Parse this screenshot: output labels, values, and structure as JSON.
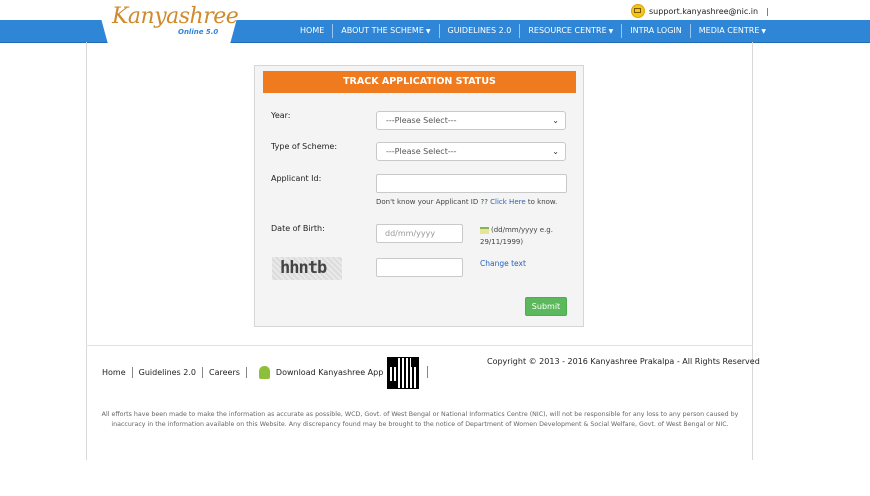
{
  "header": {
    "logo_text": "Kanyashree",
    "logo_sub": "Online 5.0",
    "support_email": "support.kanyashree@nic.in"
  },
  "nav": {
    "items": [
      {
        "label": "HOME",
        "dropdown": false
      },
      {
        "label": "ABOUT THE SCHEME",
        "dropdown": true
      },
      {
        "label": "GUIDELINES 2.0",
        "dropdown": false
      },
      {
        "label": "RESOURCE CENTRE",
        "dropdown": true
      },
      {
        "label": "INTRA LOGIN",
        "dropdown": false
      },
      {
        "label": "MEDIA CENTRE",
        "dropdown": true
      }
    ]
  },
  "form": {
    "title": "TRACK APPLICATION STATUS",
    "year_label": "Year:",
    "year_value": "---Please Select---",
    "scheme_label": "Type of Scheme:",
    "scheme_value": "---Please Select---",
    "applicant_label": "Applicant Id:",
    "applicant_value": "",
    "applicant_hint_pre": "Don't know your Applicant ID ??",
    "applicant_hint_link": "Click Here",
    "applicant_hint_post": "to know.",
    "dob_label": "Date of Birth:",
    "dob_placeholder": "dd/mm/yyyy",
    "dob_hint_line1": "(dd/mm/yyyy e.g.",
    "dob_hint_line2": "29/11/1999)",
    "captcha_text": "hhntb",
    "captcha_value": "",
    "change_text": "Change text",
    "submit_label": "Submit"
  },
  "footer": {
    "links": [
      "Home",
      "Guidelines 2.0",
      "Careers"
    ],
    "download_app": "Download Kanyashree App",
    "copyright": "Copyright © 2013 - 2016 Kanyashree Prakalpa - All Rights Reserved",
    "disclaimer": "All efforts have been made to make the information as accurate as possible, WCD, Govt. of West Bengal or National Informatics Centre (NIC), will not be responsible for any loss to any person caused by inaccuracy in the information available on this Website. Any discrepancy found may be brought to the notice of Department of Women Development & Social Welfare, Govt. of West Bengal or NIC."
  },
  "colors": {
    "nav_blue": "#2f86d6",
    "title_orange": "#f07a1e",
    "submit_green": "#5cb85c",
    "link_blue": "#2a62b8"
  }
}
